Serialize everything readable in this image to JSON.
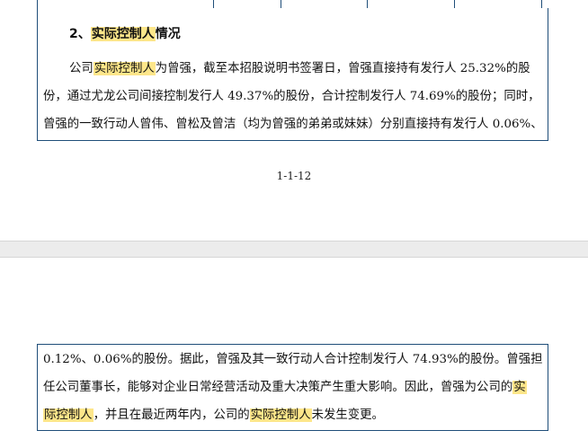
{
  "table_stub": {
    "cells": [
      "",
      "",
      "",
      ""
    ]
  },
  "section": {
    "number": "2、",
    "title_highlight": "实际控制人",
    "title_rest": "情况"
  },
  "paragraph_top": {
    "line1_a": "公司",
    "line1_hl": "实际控制人",
    "line1_b": "为曾强，截至本招股说明书签署日，曾强直接持有发行人 25.32%的股",
    "line2": "份，通过尤龙公司间接控制发行人 49.37%的股份，合计控制发行人 74.69%的股份；同时，",
    "line3": "曾强的一致行动人曾伟、曾松及曾洁（均为曾强的弟弟或妹妹）分别直接持有发行人 0.06%、"
  },
  "page_number": "1-1-12",
  "paragraph_bottom": {
    "line1": "0.12%、0.06%的股份。据此，曾强及其一致行动人合计控制发行人 74.93%的股份。曾强担",
    "line2_a": "任公司董事长，能够对企业日常经营活动及重大决策产生重大影响。因此，曾强为公司的",
    "line2_hl": "实",
    "line3_hl1": "际控制人",
    "line3_a": "，并且在最近两年内，公司的",
    "line3_hl2": "实际控制人",
    "line3_b": "未发生变更。"
  },
  "colors": {
    "border": "#1f4e79",
    "highlight": "#fde68a",
    "page_gap": "#ececec"
  }
}
